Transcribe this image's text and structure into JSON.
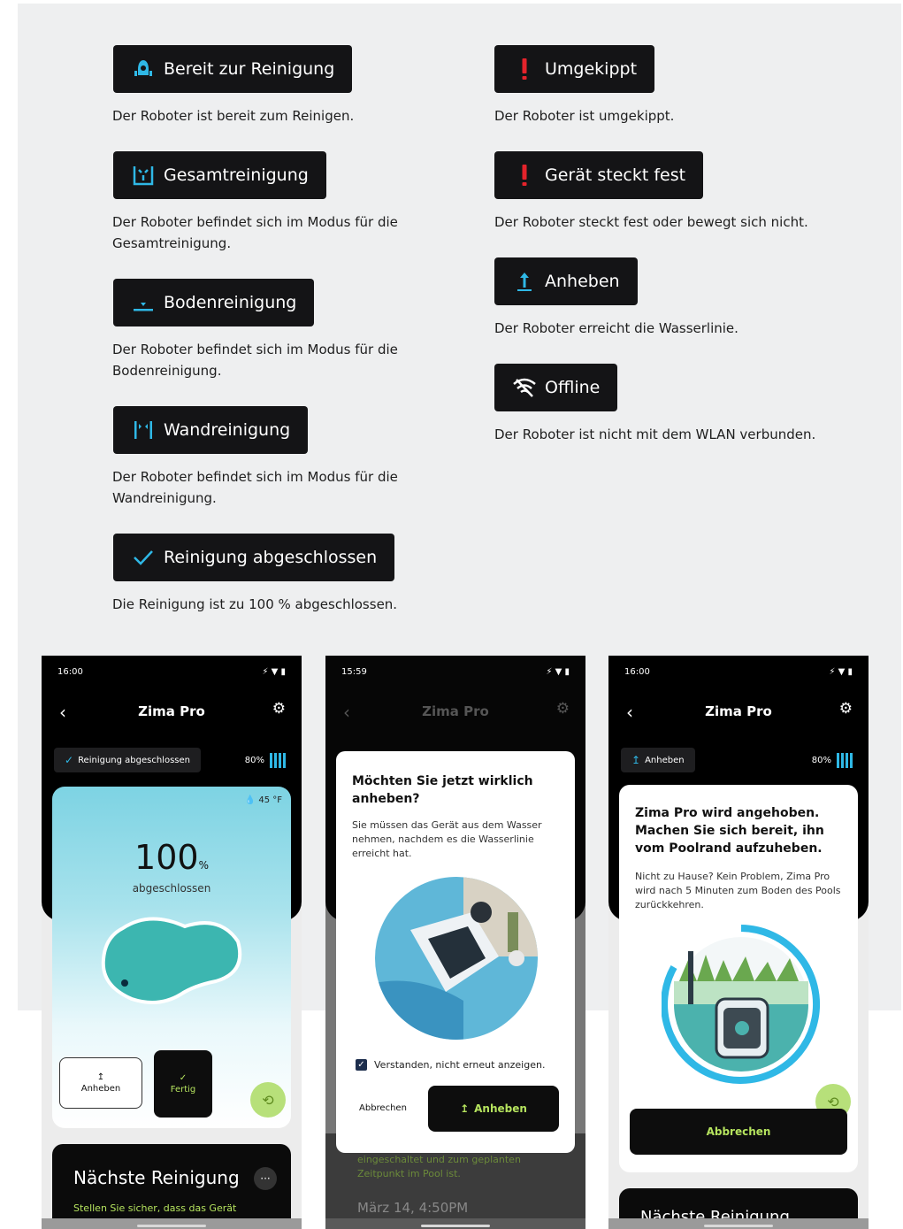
{
  "legend": {
    "left": [
      {
        "label": "Bereit zur Reinigung",
        "icon": "robot-icon",
        "desc": "Der Roboter ist bereit zum Reinigen."
      },
      {
        "label": "Gesamtreinigung",
        "icon": "full-clean-icon",
        "desc": "Der Roboter befindet sich im Modus für die Gesamtreinigung."
      },
      {
        "label": "Bodenreinigung",
        "icon": "floor-clean-icon",
        "desc": "Der Roboter befindet sich im Modus für die Bodenreinigung."
      },
      {
        "label": "Wandreinigung",
        "icon": "wall-clean-icon",
        "desc": "Der Roboter befindet sich im Modus für die Wandreinigung."
      },
      {
        "label": "Reinigung abgeschlossen",
        "icon": "check-icon",
        "desc": "Die Reinigung ist zu 100 % abgeschlossen."
      }
    ],
    "right": [
      {
        "label": "Umgekippt",
        "icon": "alert-icon",
        "desc": "Der Roboter ist umgekippt."
      },
      {
        "label": "Gerät steckt fest",
        "icon": "alert-icon",
        "desc": "Der Roboter steckt fest oder bewegt sich nicht."
      },
      {
        "label": "Anheben",
        "icon": "lift-arrow-icon",
        "desc": "Der Roboter erreicht die Wasserlinie."
      },
      {
        "label": "Offline",
        "icon": "wifi-off-icon",
        "desc": "Der Roboter ist nicht mit dem WLAN verbunden."
      }
    ]
  },
  "colors": {
    "accent": "#2fb8e6",
    "alert": "#e5232b",
    "lime": "#b5e35e",
    "dark": "#141416"
  },
  "phone1": {
    "time": "16:00",
    "title": "Zima Pro",
    "status_chip": "Reinigung abgeschlossen",
    "battery": "80%",
    "temp": "45 °F",
    "percent": "100",
    "percent_unit": "%",
    "done_label": "abgeschlossen",
    "btn_lift": "Anheben",
    "btn_done": "Fertig",
    "next_title": "Nächste Reinigung",
    "next_sub": "Stellen Sie sicher, dass das Gerät",
    "more": "···"
  },
  "phone2": {
    "time": "15:59",
    "title": "Zima Pro",
    "modal_title": "Möchten Sie jetzt wirklich anheben?",
    "modal_body": "Sie müssen das Gerät aus dem Wasser nehmen, nachdem es die Wasserlinie erreicht hat.",
    "checkbox_label": "Verstanden, nicht erneut anzeigen.",
    "cancel": "Abbrechen",
    "confirm": "Anheben",
    "behind_line1": "eingeschaltet und zum geplanten",
    "behind_line2": "Zeitpunkt im Pool ist.",
    "date": "März 14, 4:50PM"
  },
  "phone3": {
    "time": "16:00",
    "title": "Zima Pro",
    "status_chip": "Anheben",
    "battery": "80%",
    "card_title": "Zima Pro wird angehoben. Machen Sie sich bereit, ihn vom Poolrand aufzuheben.",
    "card_body": "Nicht zu Hause? Kein Problem, Zima Pro wird nach 5 Minuten zum Boden des Pools zurückkehren.",
    "cancel": "Abbrechen",
    "next_title": "Nächste Reinigung"
  }
}
